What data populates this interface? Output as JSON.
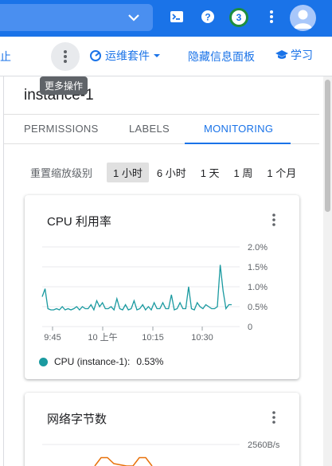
{
  "topbar": {
    "colors": {
      "bar": "#1a73e8",
      "search": "#4a8ff0",
      "badge_ring": "#1e8e3e"
    },
    "icons": [
      "chevron-down-icon",
      "cloud-shell-icon",
      "help-icon",
      "more-vert-icon",
      "account-avatar"
    ],
    "notification_count": "3"
  },
  "actionbar": {
    "cut_label": "止",
    "ops_label": "运维套件",
    "hide_panel_label": "隐藏信息面板",
    "learn_label": "学习"
  },
  "tooltip": {
    "text": "更多操作"
  },
  "panel": {
    "title": "instance-1",
    "tabs": [
      {
        "label": "PERMISSIONS",
        "active": false
      },
      {
        "label": "LABELS",
        "active": false
      },
      {
        "label": "MONITORING",
        "active": true
      }
    ],
    "zoom": {
      "label": "重置缩放级别",
      "options": [
        "1 小时",
        "6 小时",
        "1 天",
        "1 周",
        "1 个月"
      ],
      "selected": "1 小时"
    }
  },
  "cards": {
    "cpu": {
      "title": "CPU 利用率",
      "legend_label": "CPU (instance-1):",
      "legend_value": "0.53%",
      "legend_color": "#1a9aa0"
    },
    "network": {
      "title": "网络字节数",
      "y_top_label": "2560B/s",
      "line_color": "#e8710a"
    }
  },
  "chart_data": [
    {
      "type": "line",
      "title": "CPU 利用率",
      "x_tick_labels": [
        "9:45",
        "10 上午",
        "10:15",
        "10:30"
      ],
      "y_tick_labels": [
        "2.0%",
        "1.5%",
        "1.0%",
        "0.5%",
        "0"
      ],
      "ylim": [
        0,
        2.0
      ],
      "grid": true,
      "legend_position": "bottom",
      "series": [
        {
          "name": "CPU (instance-1)",
          "color": "#1a9aa0",
          "values": [
            0.75,
            0.95,
            0.45,
            0.42,
            0.42,
            0.45,
            0.42,
            0.5,
            0.42,
            0.45,
            0.42,
            0.45,
            0.5,
            0.42,
            0.5,
            0.45,
            0.45,
            0.55,
            0.42,
            0.65,
            0.5,
            0.6,
            0.45,
            0.45,
            0.5,
            0.42,
            0.7,
            0.45,
            0.42,
            0.55,
            0.42,
            0.45,
            0.65,
            0.42,
            0.45,
            0.55,
            0.42,
            0.5,
            0.42,
            0.6,
            0.45,
            0.45,
            0.6,
            0.45,
            0.45,
            0.8,
            0.42,
            0.45,
            0.6,
            0.45,
            0.45,
            1.0,
            0.45,
            0.42,
            0.6,
            0.5,
            0.45,
            0.55,
            0.5,
            0.45,
            0.45,
            0.5,
            1.55,
            0.9,
            0.45,
            0.55,
            0.55
          ]
        }
      ]
    },
    {
      "type": "line",
      "title": "网络字节数",
      "y_tick_labels": [
        "2560B/s"
      ],
      "series": [
        {
          "color": "#e8710a",
          "values": [
            0.6,
            0.95,
            0.95,
            0.7,
            0.6,
            0.6,
            0.95,
            0.95,
            0.6
          ]
        }
      ]
    }
  ]
}
